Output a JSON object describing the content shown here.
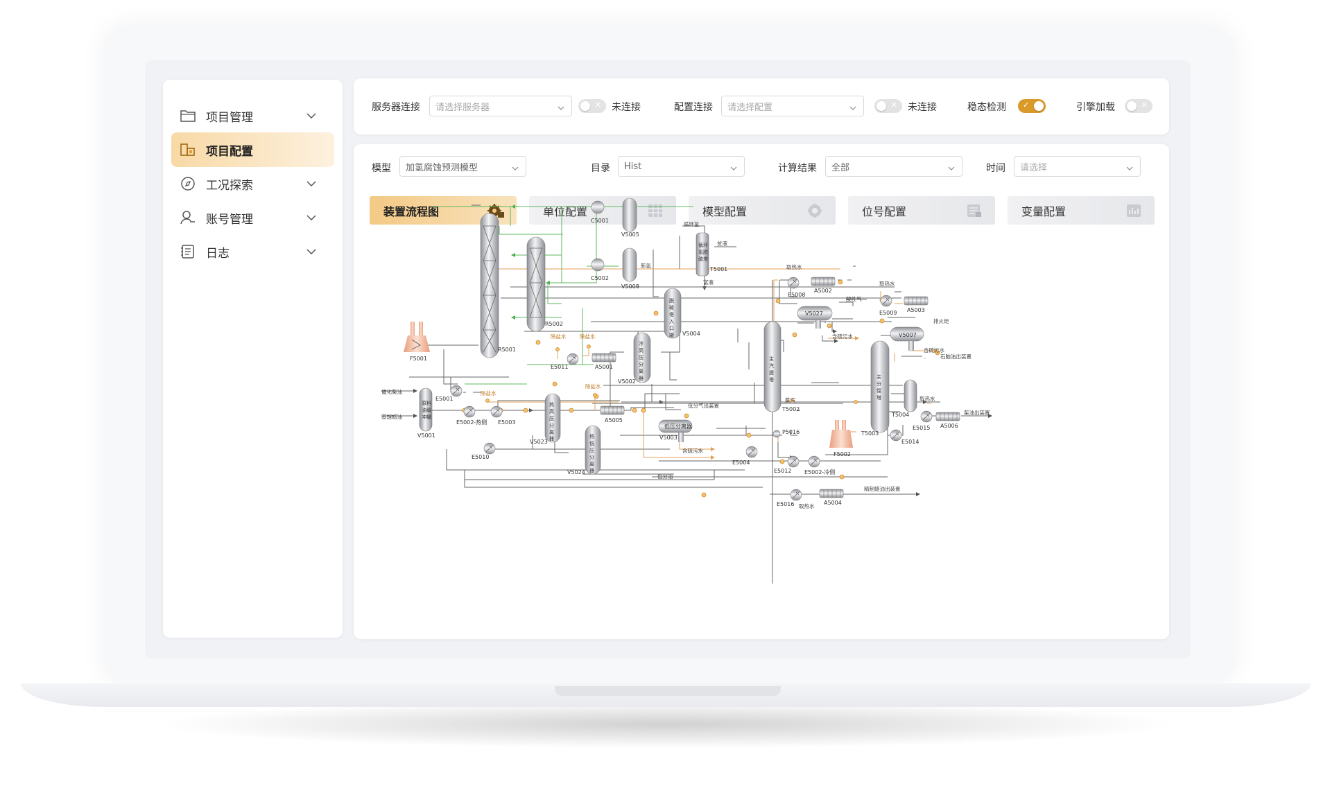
{
  "sidebar": {
    "items": [
      {
        "label": "项目管理",
        "icon": "folder-icon",
        "expandable": true
      },
      {
        "label": "项目配置",
        "icon": "config-icon",
        "active": true
      },
      {
        "label": "工况探索",
        "icon": "compass-icon",
        "expandable": true
      },
      {
        "label": "账号管理",
        "icon": "user-icon",
        "expandable": true
      },
      {
        "label": "日志",
        "icon": "log-icon",
        "expandable": true
      }
    ]
  },
  "topbar": {
    "server_label": "服务器连接",
    "server_placeholder": "请选择服务器",
    "server_status": "未连接",
    "config_label": "配置连接",
    "config_placeholder": "请选择配置",
    "config_status": "未连接",
    "steady_label": "稳态检测",
    "steady_on": true,
    "engine_label": "引擎加载",
    "engine_on": false
  },
  "filters": {
    "model_label": "模型",
    "model_value": "加氢腐蚀预测模型",
    "dir_label": "目录",
    "dir_value": "Hist",
    "calc_label": "计算结果",
    "calc_value": "全部",
    "time_label": "时间",
    "time_placeholder": "请选择"
  },
  "tabs": [
    {
      "label": "装置流程图",
      "icon": "gear-chart-icon",
      "active": true
    },
    {
      "label": "单位配置",
      "icon": "grid-icon"
    },
    {
      "label": "模型配置",
      "icon": "cube-icon"
    },
    {
      "label": "位号配置",
      "icon": "tag-table-icon"
    },
    {
      "label": "变量配置",
      "icon": "bar-chart-icon"
    }
  ],
  "diagram": {
    "vessels": {
      "R5001": "R5001",
      "R5002": "R5002",
      "F5001": "F5001",
      "V5001": "V5001",
      "V5001_text": "原料油缓冲罐",
      "V5023": "V5023",
      "V5023_text": "热高压分离器",
      "V5024": "V5024",
      "V5024_text": "热低压分离器",
      "V5002": "V5002",
      "V5002_text": "冷高压分离器",
      "V5004": "V5004",
      "V5004_text": "脱硫塔入口罐",
      "V5003": "V5003",
      "V5003_text": "低压分离器",
      "T5001": "T5001",
      "T5001_text": "循环氢脱硫塔",
      "V5005": "V5005",
      "V5008": "V5008",
      "C5001": "C5001",
      "C5002": "C5002",
      "T5002": "T5002",
      "T5002_text": "主汽提塔",
      "V5027": "V5027",
      "T5003": "T5003",
      "T5003_text": "主分馏塔",
      "V5007": "V5007",
      "T5004": "T5004",
      "F5002": "F5002",
      "P5016": "P5016"
    },
    "exchangers": {
      "E5001": "E5001",
      "E5002h": "E5002-热侧",
      "E5003": "E5003",
      "E5010": "E5010",
      "E5011": "E5011",
      "E5004": "E5004",
      "E5008": "E5008",
      "E5009": "E5009",
      "E5012": "E5012",
      "E5002c": "E5002-冷侧",
      "E5014": "E5014",
      "E5015": "E5015",
      "E5016": "E5016"
    },
    "coolers": {
      "A5001": "A5001",
      "A5005": "A5005",
      "A5002": "A5002",
      "A5003": "A5003",
      "A5004": "A5004",
      "A5006": "A5006"
    },
    "streams": {
      "feed1": "催化柴油",
      "feed2": "蒸馏蜡油",
      "desalt": "除盐水",
      "recycle_h2": "循环氢",
      "fresh_h2": "新氢",
      "lean_amine": "贫液",
      "rich_amine": "富液",
      "low_gas": "低分气出装置",
      "sour_water": "含硫污水",
      "low_oil": "低分油",
      "steam": "蒸汽",
      "cooling_water": "取热水",
      "acid_gas": "酸性气",
      "flare": "排火炬",
      "naphtha": "石脑油出装置",
      "diesel": "柴油出装置",
      "tail_oil": "精制蜡油出装置"
    }
  }
}
